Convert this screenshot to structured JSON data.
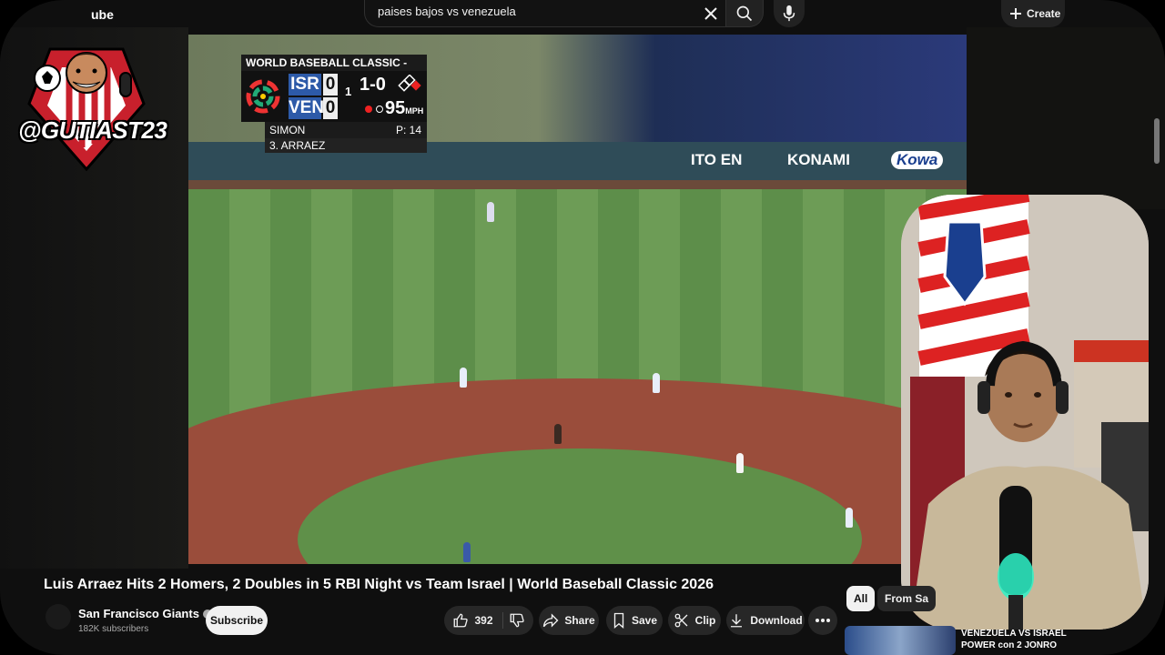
{
  "header": {
    "logo_text": "ube",
    "search": {
      "value": "paises bajos vs venezuela",
      "placeholder": "Search"
    },
    "create_label": "Create"
  },
  "overlay": {
    "handle": "@GUTIAST23"
  },
  "scoreboard": {
    "title": "WORLD BASEBALL CLASSIC - POOL D",
    "teams": [
      {
        "abbr": "ISR",
        "score": "0"
      },
      {
        "abbr": "VEN",
        "score": "0"
      }
    ],
    "inning": "1",
    "count": "1-0",
    "pitch_speed": "95",
    "pitch_unit": "MPH",
    "pitcher": "SIMON",
    "pitch_count": "P: 14",
    "batter": "3. ARRAEZ"
  },
  "ads": [
    "ITO EN",
    "KONAMI",
    "Kowa"
  ],
  "video": {
    "title": "Luis Arraez Hits 2 Homers, 2 Doubles in 5 RBI Night vs Team Israel | World Baseball Classic 2026",
    "channel": "San Francisco Giants",
    "subscribers": "182K subscribers",
    "subscribe_label": "Subscribe",
    "likes": "392",
    "share_label": "Share",
    "save_label": "Save",
    "clip_label": "Clip",
    "download_label": "Download"
  },
  "chips": {
    "all": "All",
    "from": "From Sa"
  },
  "recommendation": {
    "title": "VENEZUELA VS ISRAEL POWER con 2 JONRO"
  },
  "colors": {
    "accent": "#f1f1f1",
    "pill_bg": "#272727",
    "team_blue": "#2d5aa8"
  }
}
